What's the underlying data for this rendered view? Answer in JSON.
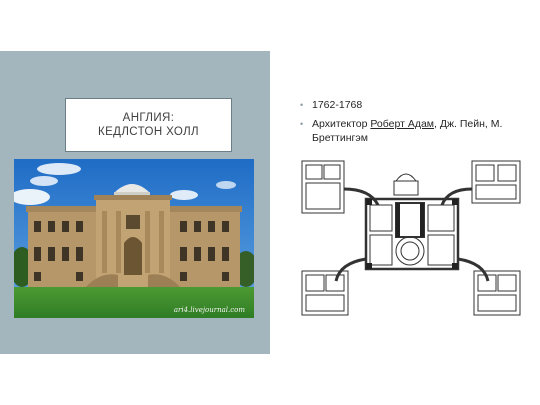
{
  "slide": {
    "title_line1": "АНГЛИЯ:",
    "title_line2": "КЕДЛСТОН ХОЛЛ",
    "bullets": {
      "dates": "1762-1768",
      "architect_prefix": "Архитектор ",
      "architect_link": "Роберт Адам",
      "architect_rest": ", Дж. Пейн, М. Бреттингэм"
    },
    "photo_watermark": "ari4.livejournal.com"
  },
  "colors": {
    "left_panel": "#a3b5bd",
    "title_border": "#6d7f86",
    "sky": "#2f7bd1",
    "lawn": "#3f8f2f",
    "stone": "#b89a6a"
  }
}
